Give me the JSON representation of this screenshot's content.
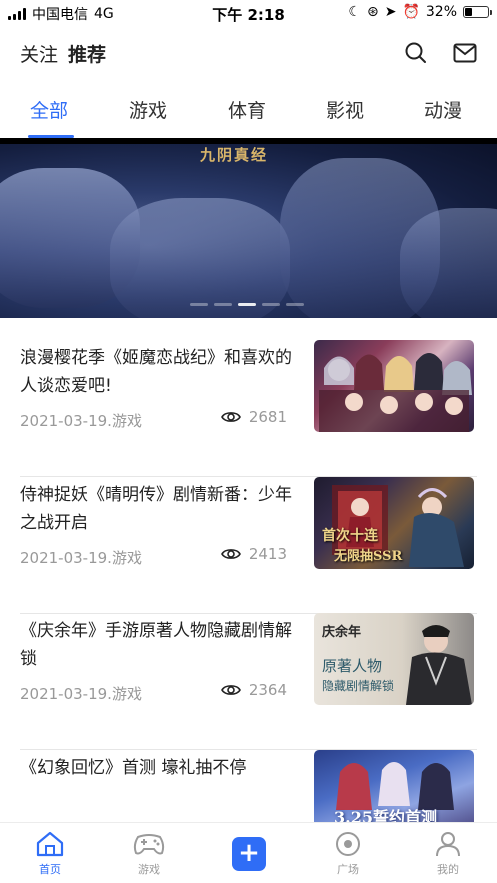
{
  "status_bar": {
    "carrier": "中国电信",
    "network": "4G",
    "time": "下午 2:18",
    "battery": "32%",
    "battery_level": 0.32
  },
  "header": {
    "tabs": [
      "关注",
      "推荐"
    ],
    "active_tab": "推荐",
    "icons": [
      "search-icon",
      "mail-icon"
    ]
  },
  "categories": {
    "items": [
      "全部",
      "游戏",
      "体育",
      "影视",
      "动漫"
    ],
    "active": "全部",
    "accent": "#2f6df6"
  },
  "banner": {
    "title": "九阴真经",
    "slide_count": 5,
    "active_slide": 3
  },
  "articles": [
    {
      "title": "浪漫樱花季《姬魔恋战纪》和喜欢的人谈恋爱吧!",
      "meta": "2021-03-19.游戏",
      "views": "2681"
    },
    {
      "title": "侍神捉妖《晴明传》剧情新番：少年之战开启",
      "meta": "2021-03-19.游戏",
      "views": "2413"
    },
    {
      "title": "《庆余年》手游原著人物隐藏剧情解锁",
      "meta": "2021-03-19.游戏",
      "views": "2364"
    },
    {
      "title": "《幻象回忆》首测 壕礼抽不停",
      "meta": "",
      "views": ""
    }
  ],
  "thumbnails": {
    "t2_line1": "首次十连",
    "t2_line2": "无限抽SSR",
    "t3_brand": "庆余年",
    "t3_line1": "原著人物",
    "t3_line2": "隐藏剧情解锁",
    "t4_text": "3.25誓约首测"
  },
  "bottom_nav": {
    "items": [
      {
        "label": "首页",
        "icon": "home-icon",
        "active": true
      },
      {
        "label": "游戏",
        "icon": "gamepad-icon",
        "active": false
      },
      {
        "label": "+",
        "icon": "plus-icon",
        "active": false
      },
      {
        "label": "广场",
        "icon": "plaza-icon",
        "active": false
      },
      {
        "label": "我的",
        "icon": "user-icon",
        "active": false
      }
    ]
  }
}
